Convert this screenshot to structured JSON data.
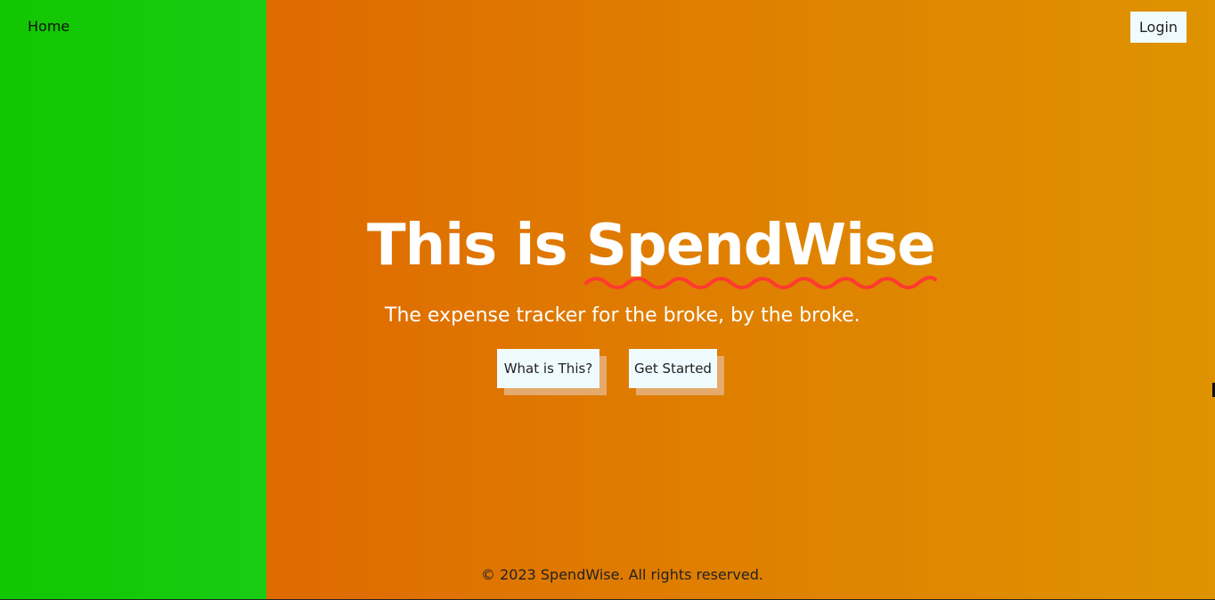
{
  "nav": {
    "home_label": "Home",
    "login_label": "Login"
  },
  "hero": {
    "title_prefix": "This is ",
    "title_brand": "SpendWise",
    "subtitle": "The expense tracker for the broke, by the broke.",
    "buttons": [
      {
        "label": "What is This?"
      },
      {
        "label": "Get Started"
      }
    ]
  },
  "footer": {
    "text": "© 2023 SpendWise. All rights reserved."
  },
  "colors": {
    "sidebar_green": "#14c800",
    "main_orange_start": "#df6a00",
    "main_orange_end": "#df9300",
    "button_bg": "#f0fbff",
    "button_shadow": "#e5aa6c",
    "squiggle_red": "#ff3b2f"
  }
}
